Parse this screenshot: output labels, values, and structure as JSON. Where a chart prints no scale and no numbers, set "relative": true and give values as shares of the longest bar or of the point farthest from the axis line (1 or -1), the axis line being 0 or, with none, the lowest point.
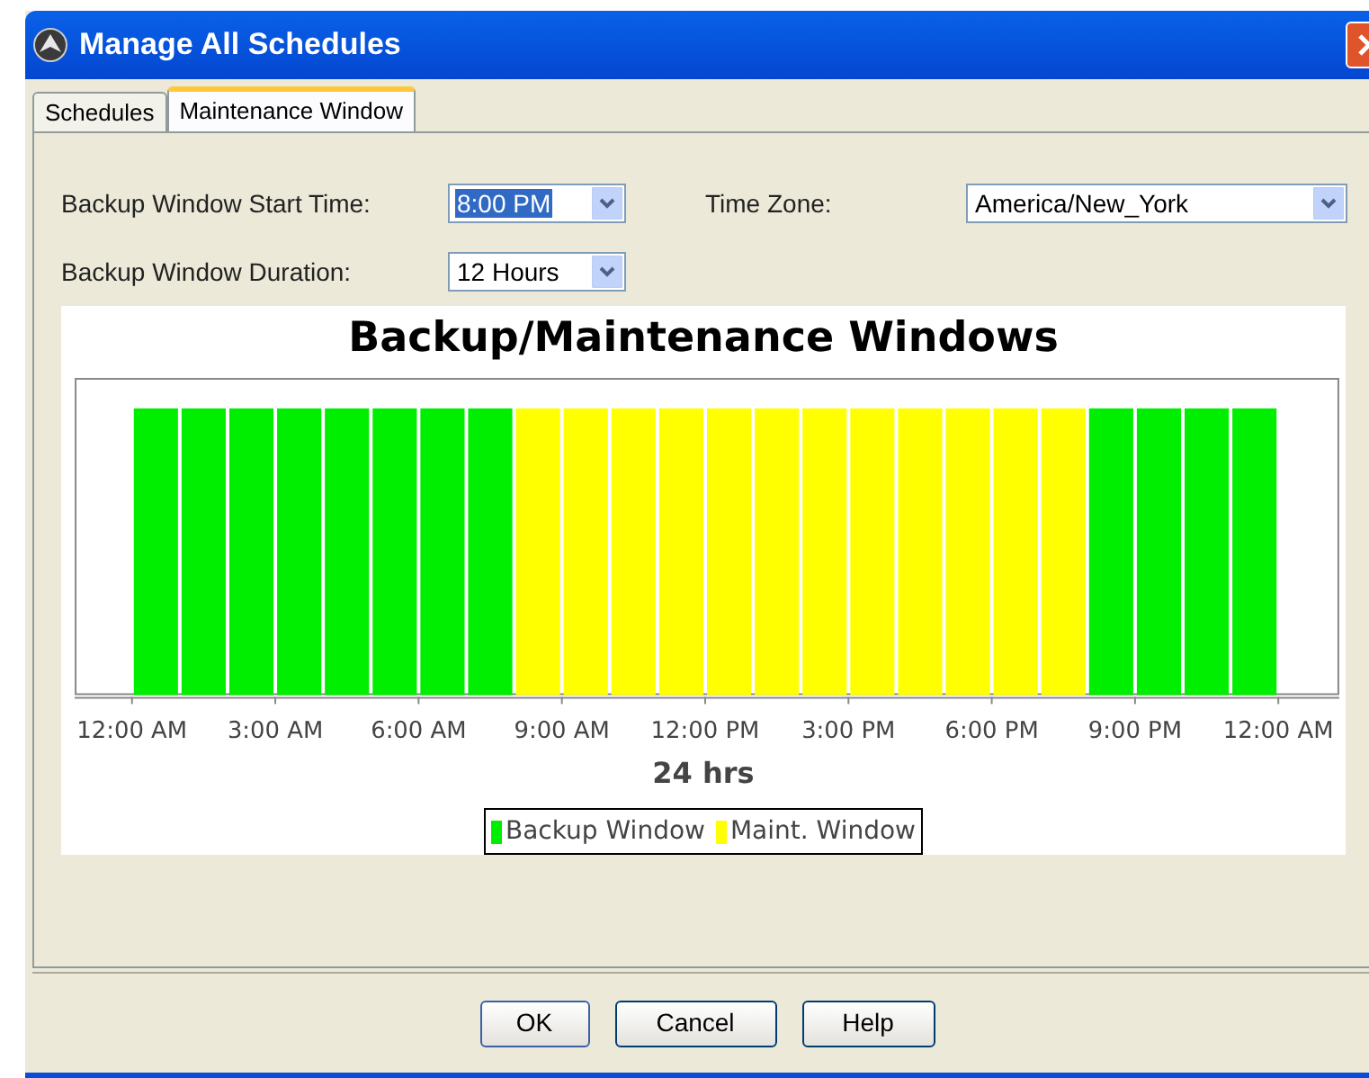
{
  "window": {
    "title": "Manage All Schedules"
  },
  "tabs": [
    {
      "label": "Schedules",
      "selected": false
    },
    {
      "label": "Maintenance Window",
      "selected": true
    }
  ],
  "form": {
    "start_time": {
      "label": "Backup Window Start Time:",
      "value": "8:00 PM",
      "focused": true
    },
    "duration": {
      "label": "Backup Window Duration:",
      "value": "12 Hours",
      "focused": false
    },
    "time_zone": {
      "label": "Time Zone:",
      "value": "America/New_York",
      "focused": false
    }
  },
  "chart": {
    "chart_data": {
      "type": "bar",
      "title": "Backup/Maintenance Windows",
      "xlabel": "24 hrs",
      "stacked": true,
      "relative": true,
      "legend": "bottom",
      "x": [
        0.5,
        1.5,
        2.5,
        3.5,
        4.5,
        5.5,
        6.5,
        7.5,
        8.5,
        9.5,
        10.5,
        11.5,
        12.5,
        13.5,
        14.5,
        15.5,
        16.5,
        17.5,
        18.5,
        19.5,
        20.5,
        21.5,
        22.5,
        23.5
      ],
      "series": [
        {
          "name": "Backup Window",
          "color": "#00ee00",
          "values": [
            1,
            1,
            1,
            1,
            1,
            1,
            1,
            1,
            0,
            0,
            0,
            0,
            0,
            0,
            0,
            0,
            0,
            0,
            0,
            0,
            1,
            1,
            1,
            1
          ]
        },
        {
          "name": "Maint. Window",
          "color": "#ffff00",
          "values": [
            0,
            0,
            0,
            0,
            0,
            0,
            0,
            0,
            1,
            1,
            1,
            1,
            1,
            1,
            1,
            1,
            1,
            1,
            1,
            1,
            0,
            0,
            0,
            0
          ]
        }
      ],
      "xlim": [
        0,
        24
      ],
      "ylim": [
        0,
        1
      ],
      "xticks": [
        {
          "value": 0,
          "label": "12:00 AM"
        },
        {
          "value": 3,
          "label": "3:00 AM"
        },
        {
          "value": 6,
          "label": "6:00 AM"
        },
        {
          "value": 9,
          "label": "9:00 AM"
        },
        {
          "value": 12,
          "label": "12:00 PM"
        },
        {
          "value": 15,
          "label": "3:00 PM"
        },
        {
          "value": 18,
          "label": "6:00 PM"
        },
        {
          "value": 21,
          "label": "9:00 PM"
        },
        {
          "value": 24,
          "label": "12:00 AM"
        }
      ]
    }
  },
  "buttons": [
    "OK",
    "Cancel",
    "Help"
  ]
}
